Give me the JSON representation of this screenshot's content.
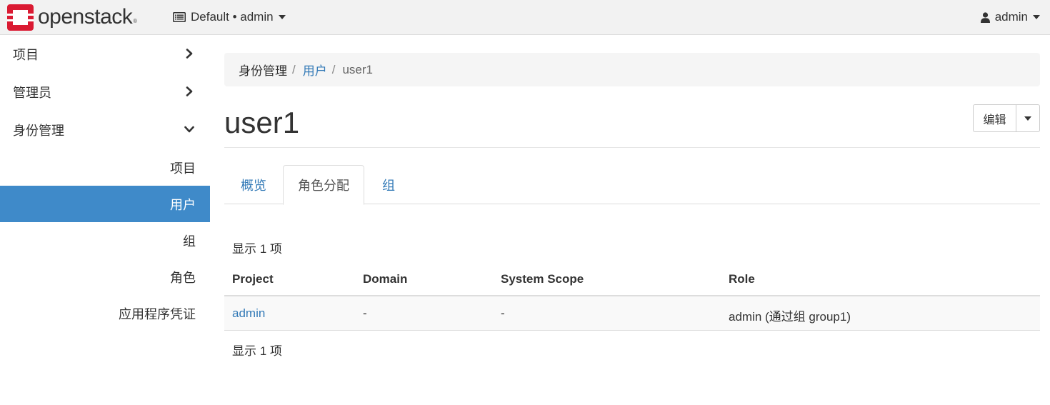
{
  "navbar": {
    "brand": "openstack",
    "brand_mark": "®",
    "project_switch": "Default • admin",
    "user": "admin"
  },
  "sidebar": {
    "groups": [
      {
        "label": "项目",
        "expanded": false
      },
      {
        "label": "管理员",
        "expanded": false
      },
      {
        "label": "身份管理",
        "expanded": true
      }
    ],
    "identity_items": [
      {
        "label": "项目",
        "active": false
      },
      {
        "label": "用户",
        "active": true
      },
      {
        "label": "组",
        "active": false
      },
      {
        "label": "角色",
        "active": false
      },
      {
        "label": "应用程序凭证",
        "active": false
      }
    ]
  },
  "breadcrumb": {
    "root": "身份管理",
    "parent": "用户",
    "current": "user1",
    "separator": "/"
  },
  "page": {
    "title": "user1",
    "edit_label": "编辑"
  },
  "tabs": [
    {
      "label": "概览",
      "active": false
    },
    {
      "label": "角色分配",
      "active": true
    },
    {
      "label": "组",
      "active": false
    }
  ],
  "table": {
    "count_text": "显示 1 项",
    "columns": [
      "Project",
      "Domain",
      "System Scope",
      "Role"
    ],
    "rows": [
      [
        "admin",
        "-",
        "-",
        "admin (通过组 group1)"
      ]
    ]
  },
  "colors": {
    "accent": "#3f8ac9",
    "link": "#337ab7",
    "brand_red": "#da1a32"
  }
}
